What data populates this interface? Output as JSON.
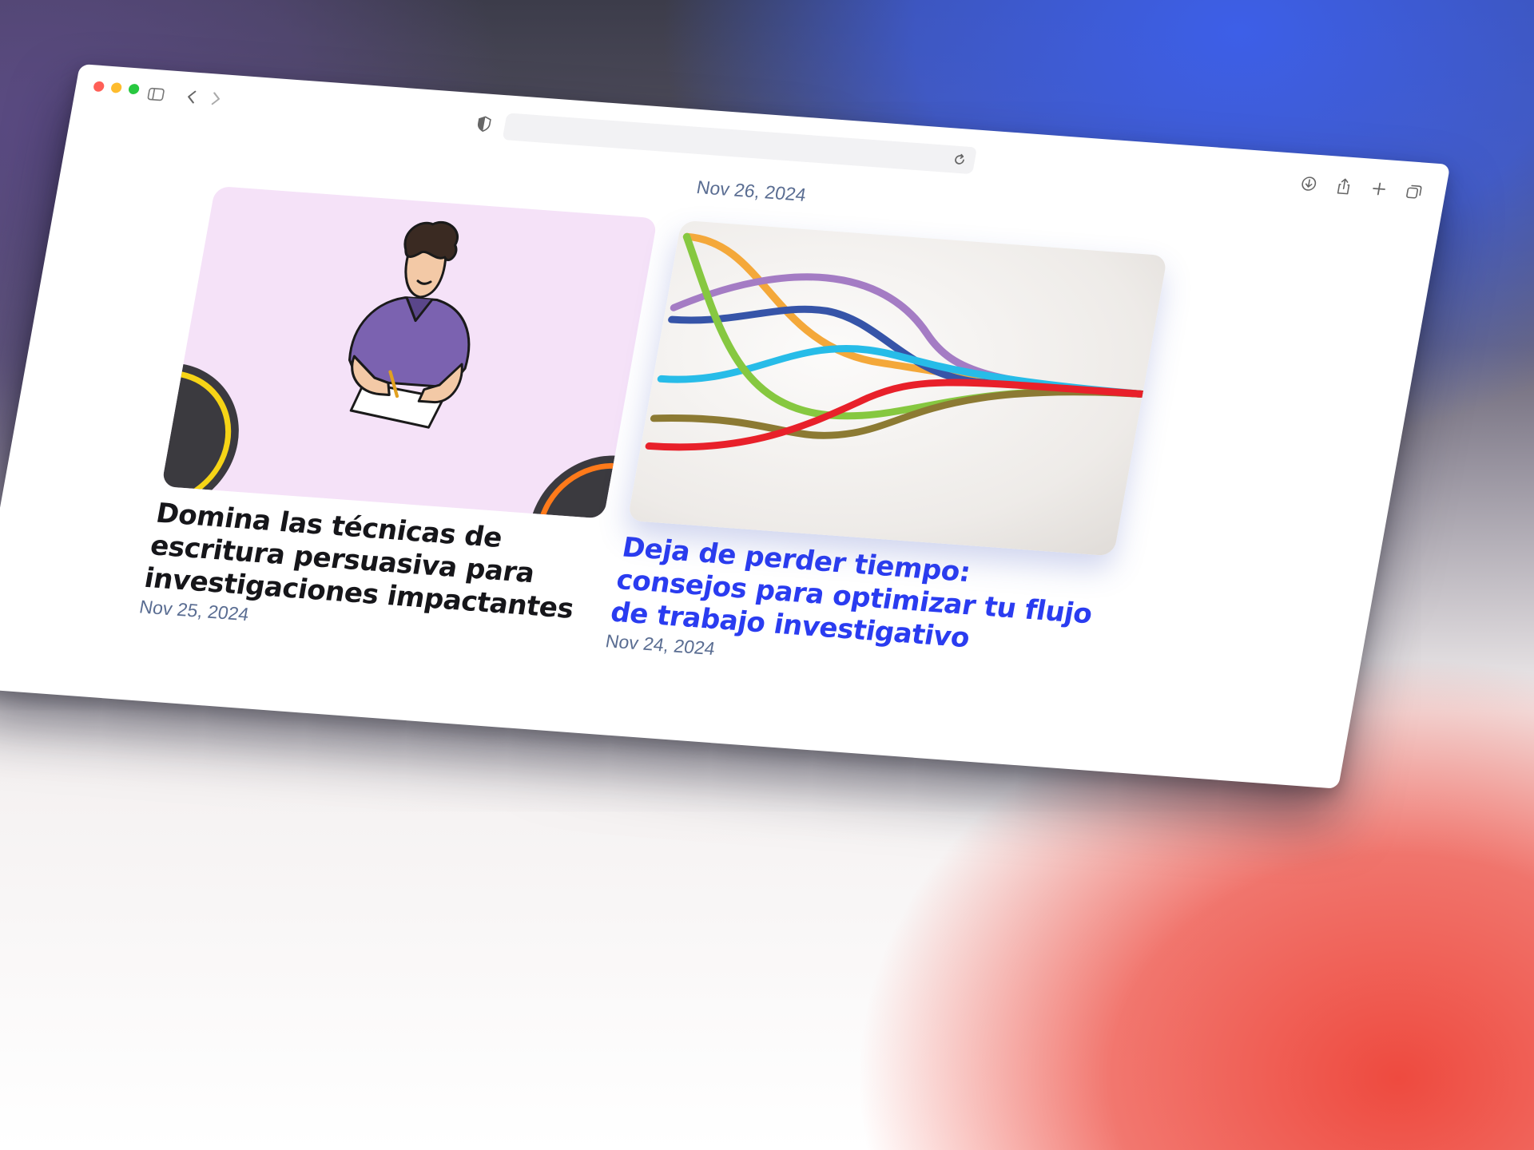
{
  "browser": {
    "address_bar_value": "",
    "icons": [
      "sidebar-icon",
      "back-icon",
      "forward-icon",
      "privacy-shield-icon",
      "reload-icon",
      "download-icon",
      "share-icon",
      "new-tab-icon",
      "tab-overview-icon"
    ]
  },
  "page": {
    "date": "Nov 26, 2024",
    "articles": [
      {
        "title": "Domina las técnicas de escritura persuasiva para investigaciones impactantes",
        "date": "Nov 25, 2024",
        "title_color": "#16161a",
        "image": "illustration-person-writing"
      },
      {
        "title": "Deja de perder tiempo: consejos para optimizar tu flujo de trabajo investigativo",
        "date": "Nov 24, 2024",
        "title_color": "#2a3cf0",
        "image": "converging-colored-lines"
      }
    ]
  },
  "colors": {
    "accent_blue": "#2a3cf0",
    "date_text": "#5a6d92",
    "thumb_purple": "#f5e2f8"
  }
}
